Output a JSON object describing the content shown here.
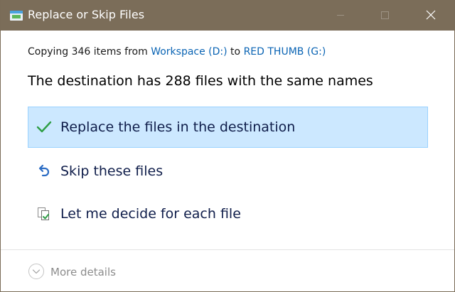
{
  "window": {
    "title": "Replace or Skip Files"
  },
  "summary": {
    "prefix": "Copying 346 items from ",
    "source": "Workspace (D:)",
    "middle": " to ",
    "destination": "RED THUMB (G:)"
  },
  "headline": "The destination has 288 files with the same names",
  "options": [
    {
      "label": "Replace the files in the destination",
      "icon": "checkmark-icon",
      "selected": true
    },
    {
      "label": "Skip these files",
      "icon": "undo-arrow-icon",
      "selected": false
    },
    {
      "label": "Let me decide for each file",
      "icon": "compare-files-icon",
      "selected": false
    }
  ],
  "footer": {
    "more_details_label": "More details"
  },
  "colors": {
    "titlebar": "#7b6d59",
    "link": "#0a64b4",
    "selection_fill": "#cce8ff",
    "selection_border": "#99d1ff",
    "check_green": "#2e9e45",
    "option_text": "#0f1d4a"
  }
}
